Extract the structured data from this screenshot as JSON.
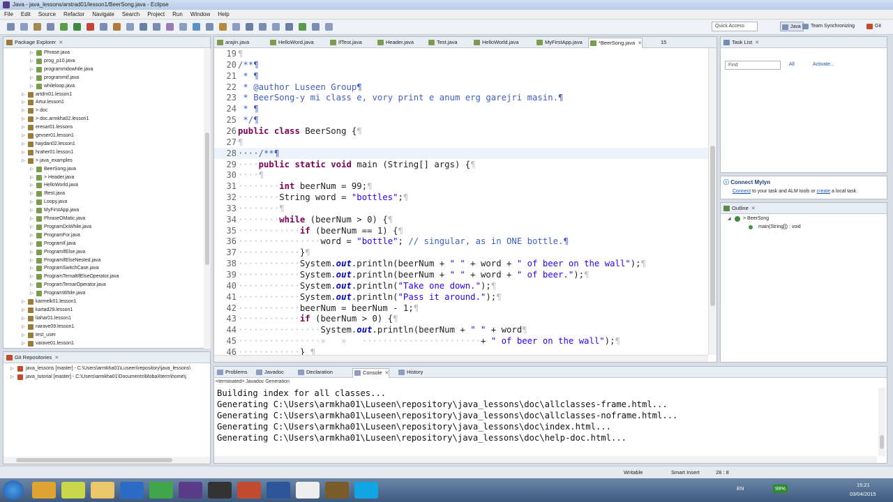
{
  "window": {
    "title": "Java - java_lessons/arstrad01/lesson1/BeerSong.java - Eclipse"
  },
  "menu": [
    "File",
    "Edit",
    "Source",
    "Refactor",
    "Navigate",
    "Search",
    "Project",
    "Run",
    "Window",
    "Help"
  ],
  "toolbar": {
    "quick_access": "Quick Access",
    "perspectives": [
      "Java",
      "Team Synchronizing",
      "Git"
    ]
  },
  "package_explorer": {
    "tab_label": "Package Explorer",
    "items": [
      {
        "label": "Phrase.java",
        "depth": 3
      },
      {
        "label": "prog_p10.java",
        "depth": 3
      },
      {
        "label": "programmdowhile.java",
        "depth": 3
      },
      {
        "label": "programmif.java",
        "depth": 3
      },
      {
        "label": "whileloop.java",
        "depth": 3
      },
      {
        "label": "artdrn01.lesson1",
        "depth": 1
      },
      {
        "label": "Artur.lesson1",
        "depth": 1
      },
      {
        "label": "> doc",
        "depth": 1
      },
      {
        "label": "> doc.armkha02.lesson1",
        "depth": 1
      },
      {
        "label": "eresar01.lessons",
        "depth": 1
      },
      {
        "label": "gevser01.lesson1",
        "depth": 1
      },
      {
        "label": "haydan02.lesson1",
        "depth": 1
      },
      {
        "label": "hraher01.lesson1",
        "depth": 1
      },
      {
        "label": "> java_examples",
        "depth": 1
      },
      {
        "label": "BeerSong.java",
        "depth": 3
      },
      {
        "label": "> Header.java",
        "depth": 3
      },
      {
        "label": "HelloWorld.java",
        "depth": 3
      },
      {
        "label": "Iftest.java",
        "depth": 3
      },
      {
        "label": "Loopy.java",
        "depth": 3
      },
      {
        "label": "MyFirstApp.java",
        "depth": 3
      },
      {
        "label": "PhraseOMatic.java",
        "depth": 3
      },
      {
        "label": "ProgramDoWhile.java",
        "depth": 3
      },
      {
        "label": "ProgramFor.java",
        "depth": 3
      },
      {
        "label": "ProgramIf.java",
        "depth": 3
      },
      {
        "label": "ProgramIfElse.java",
        "depth": 3
      },
      {
        "label": "ProgramIfElseNested.java",
        "depth": 3
      },
      {
        "label": "ProgramSwitchCase.java",
        "depth": 3
      },
      {
        "label": "ProgramTernaltIfElseOperator.java",
        "depth": 3
      },
      {
        "label": "ProgramTernarOperator.java",
        "depth": 3
      },
      {
        "label": "ProgramWhile.java",
        "depth": 3
      },
      {
        "label": "karmelk01.lesson1",
        "depth": 1
      },
      {
        "label": "kartad29.lesson1",
        "depth": 1
      },
      {
        "label": "liahar01.lesson1",
        "depth": 1
      },
      {
        "label": "narave09.lesson1",
        "depth": 1
      },
      {
        "label": "test_user",
        "depth": 1
      },
      {
        "label": "varave01.lesson1",
        "depth": 1
      }
    ]
  },
  "git_repositories": {
    "tab_label": "Git Repositories",
    "items": [
      "java_lessons [master] - C:\\Users\\armkha01\\Luseen\\repository\\java_lessons\\",
      "java_tutorial [master] - C:\\Users\\armkha01\\Documents\\MobaXterm\\home\\j"
    ]
  },
  "editor": {
    "tabs": [
      "arajin.java",
      "HelloWord.java",
      "IfTest.java",
      "Header.java",
      "Test.java",
      "HelloWorld.java",
      "MyFirstApp.java",
      "*BeerSong.java",
      "15"
    ],
    "active_tab": 7,
    "lines": [
      {
        "n": "19",
        "t": "¶"
      },
      {
        "n": "20",
        "t": "/**¶"
      },
      {
        "n": "21",
        "t": " * ¶"
      },
      {
        "n": "22",
        "t": " * @author Luseen Group¶"
      },
      {
        "n": "23",
        "t": " * BeerSong-y mi class e, vory print e anum erg garejri masin.¶"
      },
      {
        "n": "24",
        "t": " * ¶"
      },
      {
        "n": "25",
        "t": " */¶"
      },
      {
        "n": "26",
        "t": "public class BeerSong {¶"
      },
      {
        "n": "27",
        "t": "¶"
      },
      {
        "n": "28",
        "t": "····/**¶"
      },
      {
        "n": "29",
        "t": "····public static void main (String[] args) {¶"
      },
      {
        "n": "30",
        "t": "····¶"
      },
      {
        "n": "31",
        "t": "········int beerNum = 99;¶"
      },
      {
        "n": "32",
        "t": "········String word = \"bottles\";¶"
      },
      {
        "n": "33",
        "t": "········¶"
      },
      {
        "n": "34",
        "t": "········while (beerNum > 0) {¶"
      },
      {
        "n": "35",
        "t": "············if (beerNum == 1) {¶"
      },
      {
        "n": "36",
        "t": "················word = \"bottle\"; // singular, as in ONE bottle.¶"
      },
      {
        "n": "37",
        "t": "············}¶"
      },
      {
        "n": "38",
        "t": "············System.out.println(beerNum + \" \" + word + \" of beer on the wall\");¶"
      },
      {
        "n": "39",
        "t": "············System.out.println(beerNum + \" \" + word + \" of beer.\");¶"
      },
      {
        "n": "40",
        "t": "············System.out.println(\"Take one down.\");¶"
      },
      {
        "n": "41",
        "t": "············System.out.println(\"Pass it around.\");¶"
      },
      {
        "n": "42",
        "t": "············beerNum = beerNum - 1;¶"
      },
      {
        "n": "43",
        "t": "············if (beerNum > 0) {¶"
      },
      {
        "n": "44",
        "t": "················System.out.println(beerNum + \" \" + word¶"
      },
      {
        "n": "45",
        "t": "················»   »   ·······················+ \" of beer on the wall\");¶"
      },
      {
        "n": "46",
        "t": "············} ¶"
      }
    ],
    "current_line": 9
  },
  "task_list": {
    "tab_label": "Task List",
    "find_placeholder": "Find",
    "all_label": "All",
    "activate_label": "Activate..."
  },
  "mylyn": {
    "title": "Connect Mylyn",
    "connect_link": "Connect",
    "text_mid": " to your task and ALM tools or ",
    "create_link": "create",
    "text_end": " a local task."
  },
  "outline": {
    "tab_label": "Outline",
    "class_node": "> BeerSong",
    "method_node": "main(String[]) : void"
  },
  "bottom_panel": {
    "tabs": [
      "Problems",
      "Javadoc",
      "Declaration",
      "Console",
      "History"
    ],
    "active_tab": 3,
    "subtitle": "<terminated> Javadoc Generation",
    "output": [
      "Building index for all classes...",
      "Generating C:\\Users\\armkha01\\Luseen\\repository\\java_lessons\\doc\\allclasses-frame.html...",
      "Generating C:\\Users\\armkha01\\Luseen\\repository\\java_lessons\\doc\\allclasses-noframe.html...",
      "Generating C:\\Users\\armkha01\\Luseen\\repository\\java_lessons\\doc\\index.html...",
      "Generating C:\\Users\\armkha01\\Luseen\\repository\\java_lessons\\doc\\help-doc.html..."
    ]
  },
  "status": {
    "writable": "Writable",
    "insert_mode": "Smart Insert",
    "position": "28 : 8"
  },
  "taskbar": {
    "lang": "EN",
    "battery": "99%",
    "time": "15:21",
    "date": "03/04/2015"
  },
  "colors": {
    "keyword": "#7f0055",
    "comment": "#3f5fbf",
    "string": "#2a00ff",
    "field": "#0000c0"
  }
}
